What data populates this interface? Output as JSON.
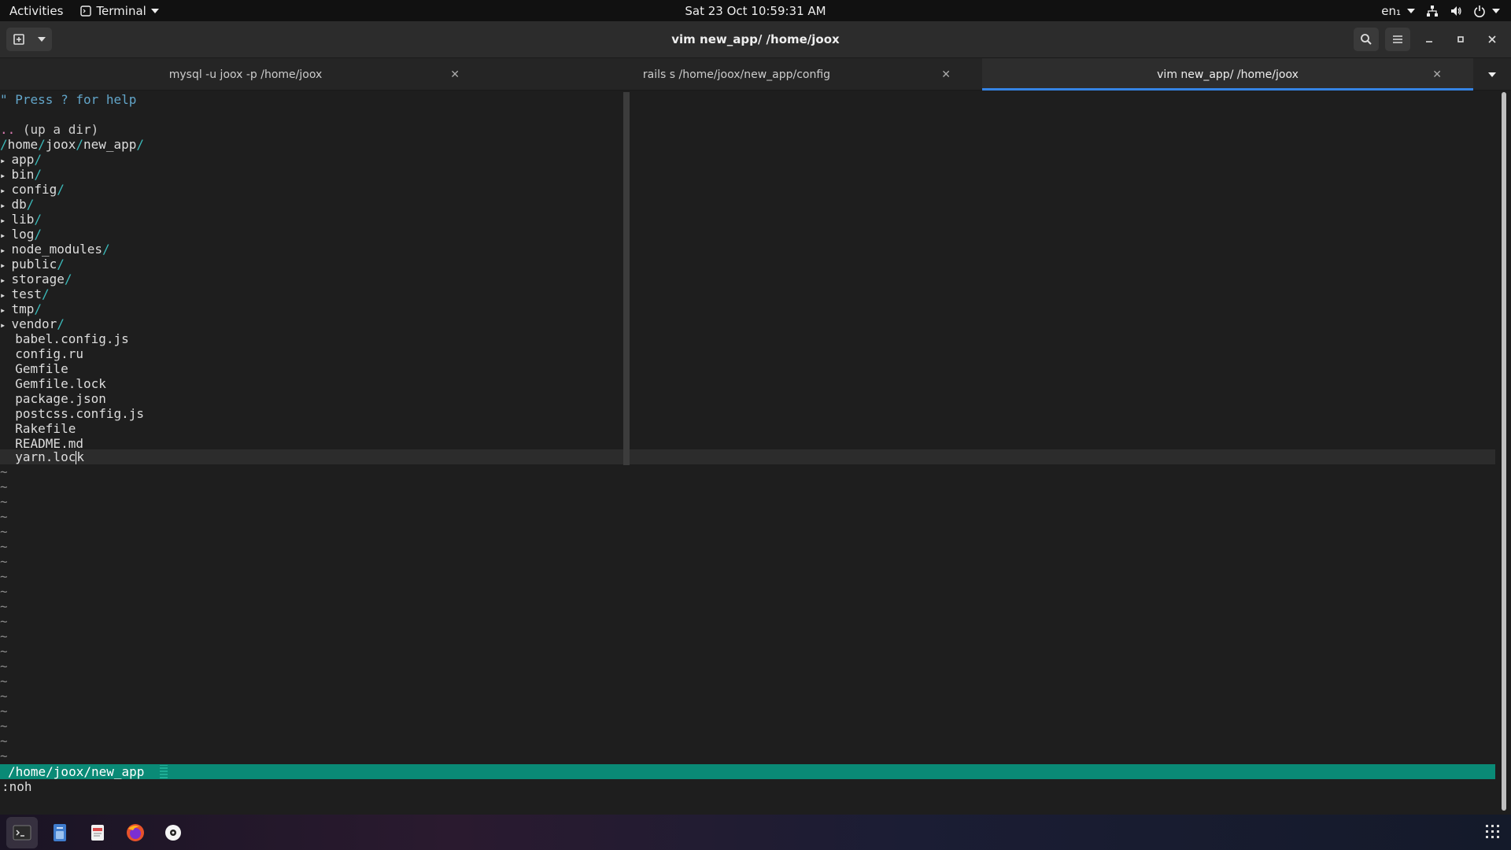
{
  "topbar": {
    "activities": "Activities",
    "app_menu_label": "Terminal",
    "clock": "Sat 23 Oct  10:59:31 AM",
    "lang": "en₁"
  },
  "window": {
    "title": "vim new_app/ /home/joox"
  },
  "tabs": [
    {
      "label": "mysql -u joox -p /home/joox",
      "active": false
    },
    {
      "label": "rails s /home/joox/new_app/config",
      "active": false
    },
    {
      "label": "vim new_app/ /home/joox",
      "active": true
    }
  ],
  "vim": {
    "help_line": "\" Press ? for help",
    "up_dir_dots": "..",
    "up_dir_text": " (up a dir)",
    "cwd_parts": [
      "home",
      "joox",
      "new_app"
    ],
    "directories": [
      "app",
      "bin",
      "config",
      "db",
      "lib",
      "log",
      "node_modules",
      "public",
      "storage",
      "test",
      "tmp",
      "vendor"
    ],
    "files": [
      "babel.config.js",
      "config.ru",
      "Gemfile",
      "Gemfile.lock",
      "package.json",
      "postcss.config.js",
      "Rakefile",
      "README.md"
    ],
    "cursor_file_before": "yarn.loc",
    "cursor_file_after": "k",
    "tilde_count": 20,
    "statusline": "/home/joox/new_app",
    "cmdline": ":noh"
  },
  "dock": {
    "apps": [
      "terminal-icon",
      "files-icon",
      "text-editor-icon",
      "firefox-icon",
      "rhythmbox-icon"
    ]
  },
  "colors": {
    "statusline_bg": "#0a8a76",
    "tab_active_underline": "#3584e4",
    "dir_slash": "#3bb9b9",
    "comment": "#62a5c9"
  }
}
